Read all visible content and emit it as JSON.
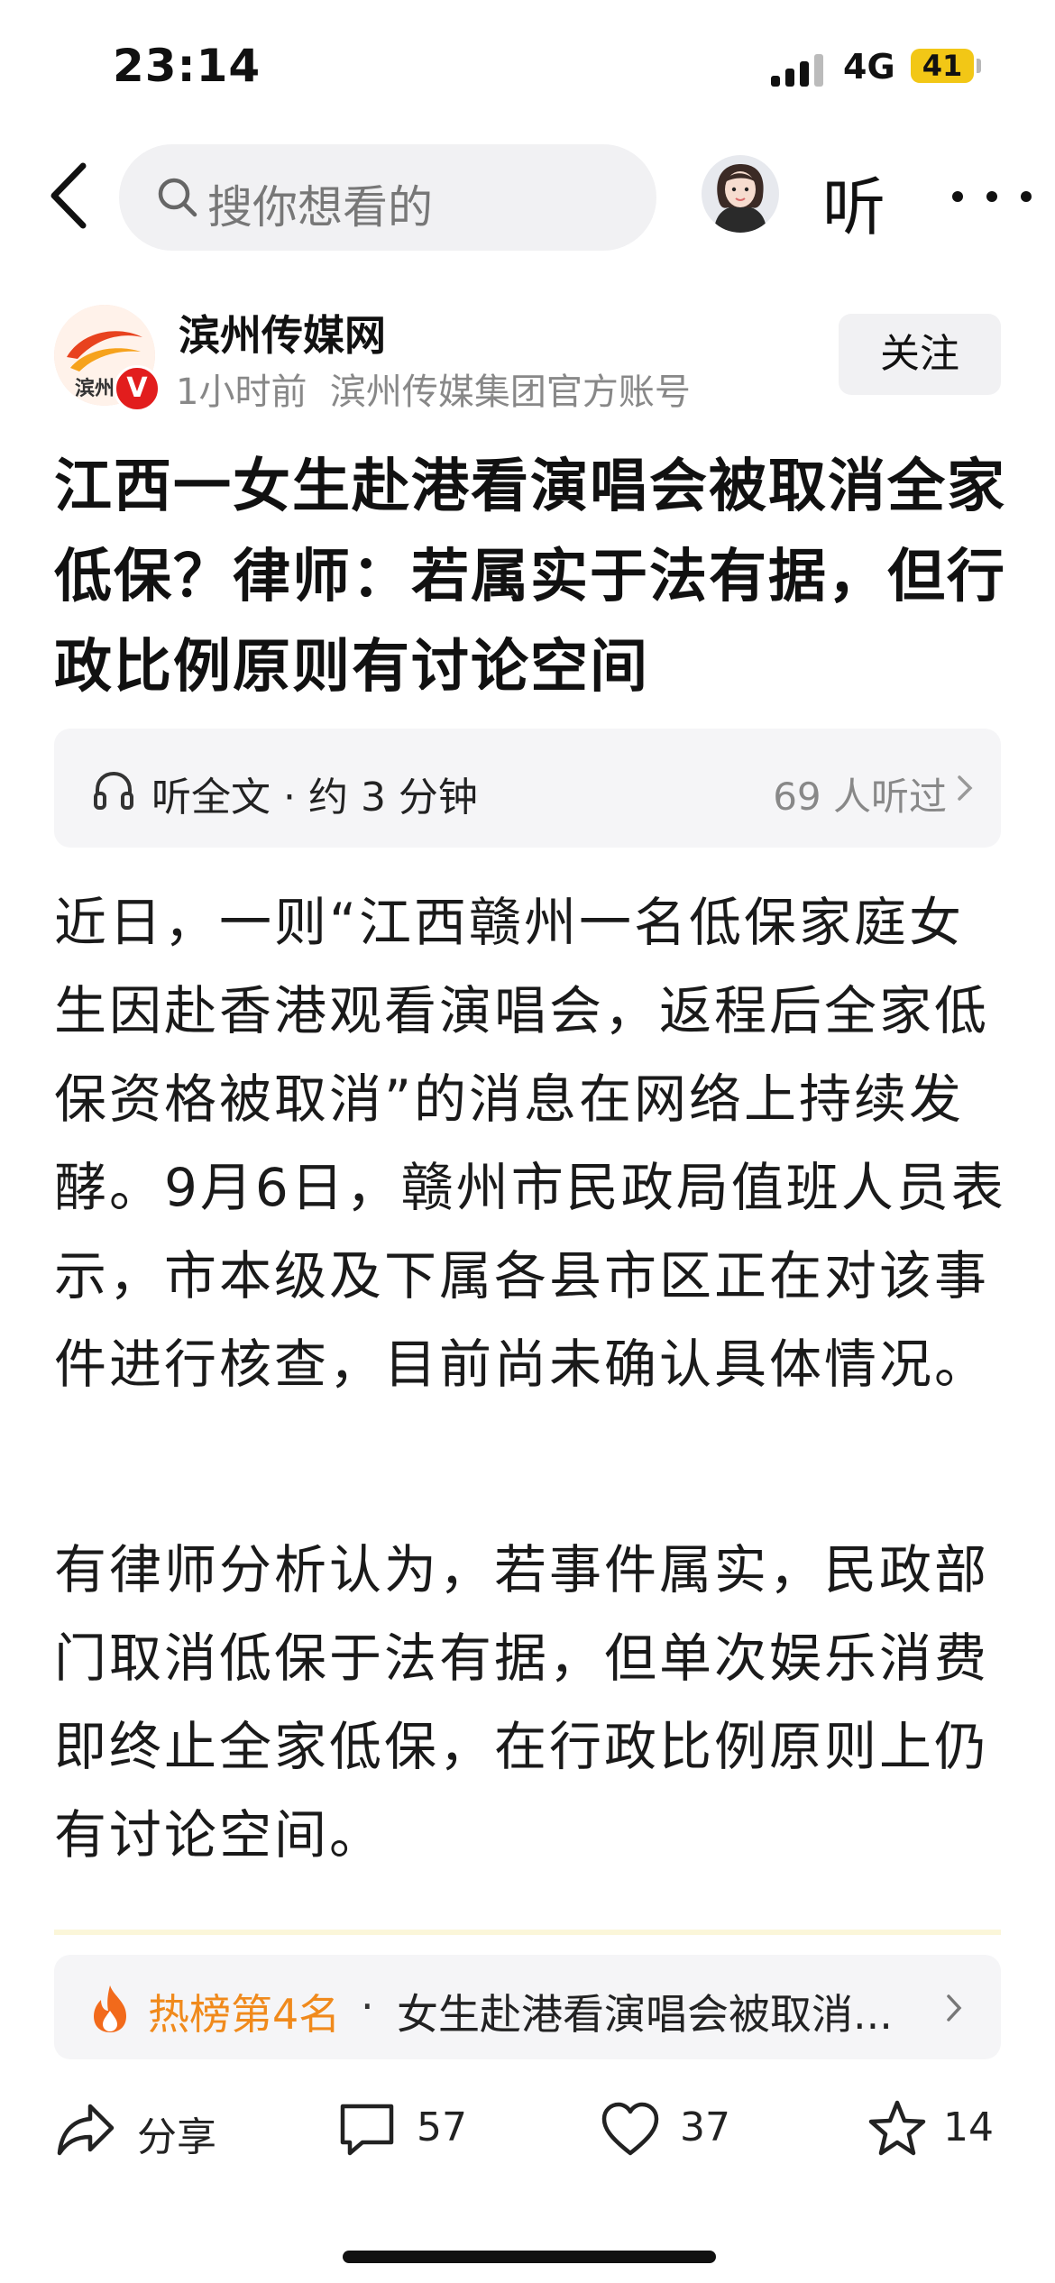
{
  "status_bar": {
    "time": "23:14",
    "network": "4G",
    "battery": "41"
  },
  "nav": {
    "search_placeholder": "搜你想看的",
    "listen_label": "听"
  },
  "author": {
    "logo_text": "滨州传",
    "name": "滨州传媒网",
    "time_ago": "1小时前",
    "account_desc": "滨州传媒集团官方账号",
    "verified_badge": "V",
    "follow_label": "关注"
  },
  "article": {
    "title": "江西一女生赴港看演唱会被取消全家低保？律师：若属实于法有据，但行政比例原则有讨论空间",
    "listen_full": "听全文 · 约 3 分钟",
    "listeners": "69 人听过",
    "paragraphs": [
      "近日，一则“江西赣州一名低保家庭女生因赴香港观看演唱会，返程后全家低保资格被取消”的消息在网络上持续发酵。9月6日，赣州市民政局值班人员表示，市本级及下属各县市区正在对该事件进行核查，目前尚未确认具体情况。",
      "有律师分析认为，若事件属实，民政部门取消低保于法有据，但单次娱乐消费即终止全家低保，在行政比例原则上仍有讨论空间。"
    ]
  },
  "hot": {
    "rank": "热榜第4名",
    "separator": "·",
    "title": "女生赴港看演唱会被取消..."
  },
  "actions": {
    "share_label": "分享",
    "comments": "57",
    "likes": "37",
    "favorites": "14"
  },
  "colors": {
    "accent_orange": "#f08a1c",
    "badge_red": "#e21d1d",
    "battery_yellow": "#f2c716"
  }
}
